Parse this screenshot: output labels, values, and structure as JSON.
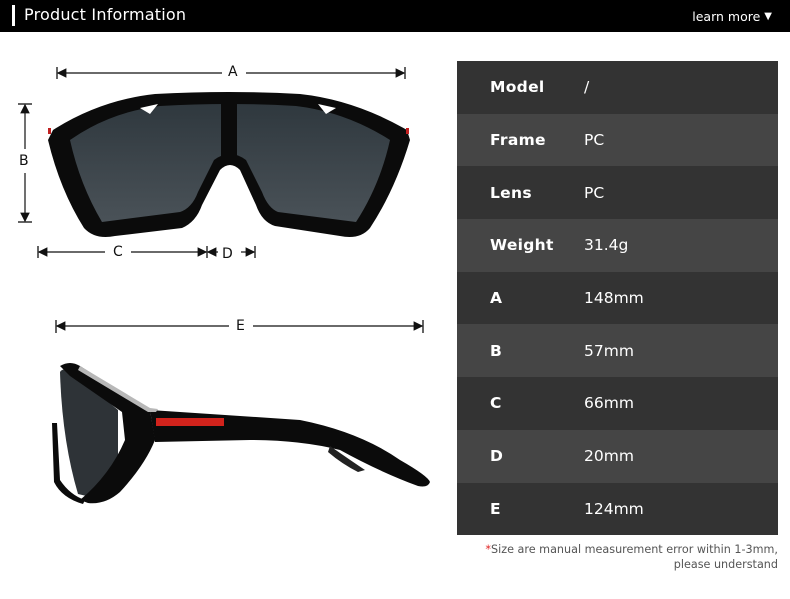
{
  "header": {
    "title": "Product Information",
    "learn_more": "learn more",
    "learn_more_icon": "triangle-down-icon"
  },
  "diagram": {
    "front_view": {
      "labels": {
        "A": "A",
        "B": "B",
        "C": "C",
        "D": "D"
      }
    },
    "side_view": {
      "labels": {
        "E": "E"
      }
    },
    "colors": {
      "frame": "#0b0b0b",
      "lens": "#3b4349",
      "temple_stripe": "#d2231c"
    }
  },
  "specs": {
    "rows": [
      {
        "label": "Model",
        "value": "/"
      },
      {
        "label": "Frame",
        "value": "PC"
      },
      {
        "label": "Lens",
        "value": "PC"
      },
      {
        "label": "Weight",
        "value": "31.4g"
      },
      {
        "label": "A",
        "value": "148mm"
      },
      {
        "label": "B",
        "value": "57mm"
      },
      {
        "label": "C",
        "value": "66mm"
      },
      {
        "label": "D",
        "value": "20mm"
      },
      {
        "label": "E",
        "value": "124mm"
      }
    ]
  },
  "footnote": {
    "star": "*",
    "line1": "Size are manual measurement error within 1-3mm,",
    "line2": "please understand"
  }
}
